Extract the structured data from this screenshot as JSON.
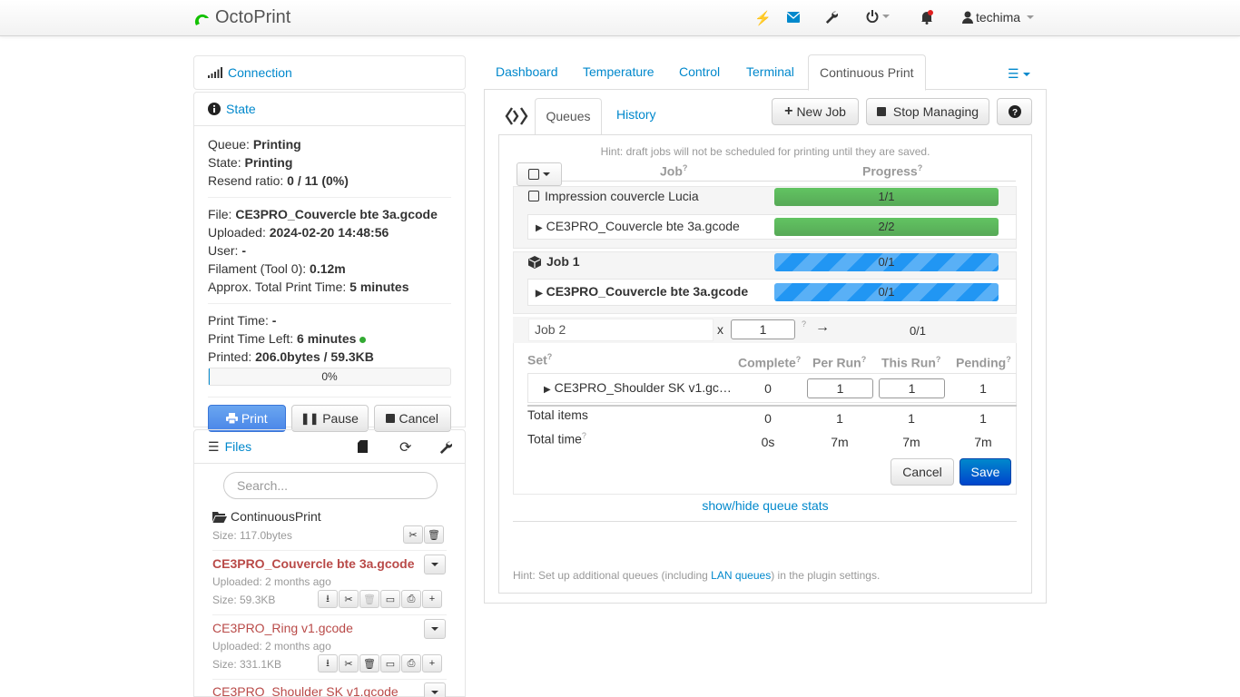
{
  "navbar": {
    "brand": "OctoPrint",
    "user": "techima"
  },
  "sidebar": {
    "connection_title": "Connection",
    "state_title": "State",
    "state": {
      "queue_label": "Queue:",
      "queue_value": "Printing",
      "state_label": "State:",
      "state_value": "Printing",
      "resend_label": "Resend ratio:",
      "resend_value": "0 / 11 (0%)",
      "file_label": "File:",
      "file_value": "CE3PRO_Couvercle bte 3a.gcode",
      "uploaded_label": "Uploaded:",
      "uploaded_value": "2024-02-20 14:48:56",
      "user_label": "User:",
      "user_value": "-",
      "filament_label": "Filament (Tool 0):",
      "filament_value": "0.12m",
      "total_label": "Approx. Total Print Time:",
      "total_value": "5 minutes",
      "print_time_label": "Print Time:",
      "print_time_value": "-",
      "time_left_label": "Print Time Left:",
      "time_left_value": "6 minutes",
      "printed_label": "Printed:",
      "printed_value": "206.0bytes / 59.3KB",
      "progress_text": "0%",
      "progress_fraction": 0.0
    },
    "buttons": {
      "print": "Print",
      "pause": "Pause",
      "cancel": "Cancel"
    },
    "files_title": "Files",
    "search_placeholder": "Search...",
    "folder": {
      "name": "ContinuousPrint",
      "size": "Size: 117.0bytes"
    },
    "files": [
      {
        "name": "CE3PRO_Couvercle bte 3a.gcode",
        "uploaded": "Uploaded: 2 months ago",
        "size": "Size: 59.3KB"
      },
      {
        "name": "CE3PRO_Ring v1.gcode",
        "uploaded": "Uploaded: 2 months ago",
        "size": "Size: 331.1KB"
      },
      {
        "name": "CE3PRO_Shoulder SK v1.gcode"
      }
    ]
  },
  "tabs": [
    "Dashboard",
    "Temperature",
    "Control",
    "Terminal",
    "Continuous Print"
  ],
  "cpq": {
    "subtabs": [
      "Queues",
      "History"
    ],
    "new_job": "New Job",
    "stop_managing": "Stop Managing",
    "hint_top": "Hint: draft jobs will not be scheduled for printing until they are saved.",
    "col_job": "Job",
    "col_progress": "Progress",
    "jobs": [
      {
        "name": "Impression couvercle Lucia",
        "progress": "1/1",
        "set": "CE3PRO_Couvercle bte 3a.gcode",
        "set_progress": "2/2"
      },
      {
        "name": "Job 1",
        "progress": "0/1",
        "set": "CE3PRO_Couvercle bte 3a.gcode",
        "set_progress": "0/1"
      }
    ],
    "edit": {
      "name": "Job 2",
      "x": "x",
      "count": "1",
      "arrow": "→",
      "progress": "0/1",
      "headers": [
        "Set",
        "Complete",
        "Per Run",
        "This Run",
        "Pending"
      ],
      "set_name": "CE3PRO_Shoulder SK v1.gc…",
      "set_complete": "0",
      "set_per_run": "1",
      "set_this_run": "1",
      "set_pending": "1",
      "total_items_label": "Total items",
      "total_items": [
        "0",
        "1",
        "1",
        "1"
      ],
      "total_time_label": "Total time",
      "total_time": [
        "0s",
        "7m",
        "7m",
        "7m"
      ],
      "cancel": "Cancel",
      "save": "Save"
    },
    "stats_link": "show/hide queue stats",
    "hint_bottom_1": "Hint: Set up additional queues (including ",
    "hint_bottom_link": "LAN queues",
    "hint_bottom_2": ") in the plugin settings."
  }
}
